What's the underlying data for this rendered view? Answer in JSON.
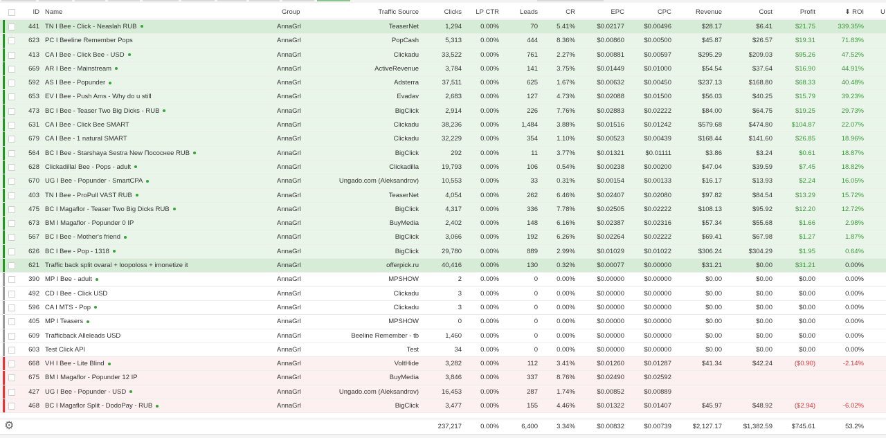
{
  "tabs": [
    "",
    "",
    "",
    "",
    "",
    "",
    "",
    "",
    "",
    "",
    ""
  ],
  "columns": {
    "id": "ID",
    "name": "Name",
    "group": "Group",
    "source": "Traffic Source",
    "clicks": "Clicks",
    "lpctr": "LP CTR",
    "leads": "Leads",
    "cr": "CR",
    "epc": "EPC",
    "cpc": "CPC",
    "revenue": "Revenue",
    "cost": "Cost",
    "profit": "Profit",
    "roi": "ROI",
    "extra": "U"
  },
  "sort_indicator": "⬇",
  "rows": [
    {
      "id": "441",
      "name": "TN I Bee - Click - Neaslah RUB",
      "dot": true,
      "group": "AnnaGrl",
      "source": "TeaserNet",
      "clicks": "1,294",
      "lpctr": "0.00%",
      "leads": "70",
      "cr": "5.41%",
      "epc": "$0.02177",
      "cpc": "$0.00496",
      "revenue": "$28.17",
      "cost": "$6.41",
      "profit": "$21.75",
      "roi": "339.35%",
      "status": "green",
      "hi": true
    },
    {
      "id": "623",
      "name": "PC I Beeline Remember Pops",
      "dot": false,
      "group": "AnnaGrl",
      "source": "PopCash",
      "clicks": "5,313",
      "lpctr": "0.00%",
      "leads": "444",
      "cr": "8.36%",
      "epc": "$0.00860",
      "cpc": "$0.00500",
      "revenue": "$45.87",
      "cost": "$26.57",
      "profit": "$19.31",
      "roi": "71.83%",
      "status": "green"
    },
    {
      "id": "413",
      "name": "CA I Bee - Click Bee - USD",
      "dot": true,
      "group": "AnnaGrl",
      "source": "Clickadu",
      "clicks": "33,522",
      "lpctr": "0.00%",
      "leads": "761",
      "cr": "2.27%",
      "epc": "$0.00881",
      "cpc": "$0.00597",
      "revenue": "$295.29",
      "cost": "$209.03",
      "profit": "$95.26",
      "roi": "47.52%",
      "status": "green"
    },
    {
      "id": "669",
      "name": "AR I Bee - Mainstream",
      "dot": true,
      "group": "AnnaGrl",
      "source": "ActiveRevenue",
      "clicks": "3,784",
      "lpctr": "0.00%",
      "leads": "141",
      "cr": "3.75%",
      "epc": "$0.01449",
      "cpc": "$0.01000",
      "revenue": "$54.54",
      "cost": "$37.64",
      "profit": "$16.90",
      "roi": "44.91%",
      "status": "green"
    },
    {
      "id": "592",
      "name": "AS I Bee - Popunder",
      "dot": true,
      "group": "AnnaGrl",
      "source": "Adsterra",
      "clicks": "37,511",
      "lpctr": "0.00%",
      "leads": "625",
      "cr": "1.67%",
      "epc": "$0.00632",
      "cpc": "$0.00450",
      "revenue": "$237.13",
      "cost": "$168.80",
      "profit": "$68.33",
      "roi": "40.48%",
      "status": "green"
    },
    {
      "id": "653",
      "name": "EV I Bee - Push Ams - Why do u still",
      "dot": false,
      "group": "AnnaGrl",
      "source": "Evadav",
      "clicks": "2,683",
      "lpctr": "0.00%",
      "leads": "127",
      "cr": "4.73%",
      "epc": "$0.02088",
      "cpc": "$0.01500",
      "revenue": "$56.03",
      "cost": "$40.25",
      "profit": "$15.79",
      "roi": "39.23%",
      "status": "green"
    },
    {
      "id": "473",
      "name": "BC I Bee - Teaser Two Big Dicks - RUB",
      "dot": true,
      "group": "AnnaGrl",
      "source": "BigClick",
      "clicks": "2,914",
      "lpctr": "0.00%",
      "leads": "226",
      "cr": "7.76%",
      "epc": "$0.02883",
      "cpc": "$0.02222",
      "revenue": "$84.00",
      "cost": "$64.75",
      "profit": "$19.25",
      "roi": "29.73%",
      "status": "green"
    },
    {
      "id": "631",
      "name": "CA I Bee - Click Bee SMART",
      "dot": false,
      "group": "AnnaGrl",
      "source": "Clickadu",
      "clicks": "38,236",
      "lpctr": "0.00%",
      "leads": "1,484",
      "cr": "3.88%",
      "epc": "$0.01516",
      "cpc": "$0.01242",
      "revenue": "$579.68",
      "cost": "$474.80",
      "profit": "$104.87",
      "roi": "22.07%",
      "status": "green"
    },
    {
      "id": "679",
      "name": "CA I Bee - 1 natural SMART",
      "dot": false,
      "group": "AnnaGrl",
      "source": "Clickadu",
      "clicks": "32,229",
      "lpctr": "0.00%",
      "leads": "354",
      "cr": "1.10%",
      "epc": "$0.00523",
      "cpc": "$0.00439",
      "revenue": "$168.44",
      "cost": "$141.60",
      "profit": "$26.85",
      "roi": "18.96%",
      "status": "green"
    },
    {
      "id": "564",
      "name": "BC I Bee - Starshaya Sestra New Пососнее RUB",
      "dot": true,
      "group": "AnnaGrl",
      "source": "BigClick",
      "clicks": "292",
      "lpctr": "0.00%",
      "leads": "11",
      "cr": "3.77%",
      "epc": "$0.01321",
      "cpc": "$0.01111",
      "revenue": "$3.86",
      "cost": "$3.24",
      "profit": "$0.61",
      "roi": "18.87%",
      "status": "green"
    },
    {
      "id": "628",
      "name": "ClickadillaI Bee - Pops - adult",
      "dot": true,
      "group": "AnnaGrl",
      "source": "Clickadilla",
      "clicks": "19,793",
      "lpctr": "0.00%",
      "leads": "106",
      "cr": "0.54%",
      "epc": "$0.00238",
      "cpc": "$0.00200",
      "revenue": "$47.04",
      "cost": "$39.59",
      "profit": "$7.45",
      "roi": "18.82%",
      "status": "green"
    },
    {
      "id": "670",
      "name": "UG I Bee - Popunder - SmartCPA",
      "dot": true,
      "group": "AnnaGrl",
      "source": "Ungado.com (Aleksandrov)",
      "clicks": "10,553",
      "lpctr": "0.00%",
      "leads": "33",
      "cr": "0.31%",
      "epc": "$0.00154",
      "cpc": "$0.00133",
      "revenue": "$16.17",
      "cost": "$13.93",
      "profit": "$2.24",
      "roi": "16.05%",
      "status": "green"
    },
    {
      "id": "403",
      "name": "TN I Bee - ProPull VAST RUB",
      "dot": true,
      "group": "AnnaGrl",
      "source": "TeaserNet",
      "clicks": "4,054",
      "lpctr": "0.00%",
      "leads": "262",
      "cr": "6.46%",
      "epc": "$0.02407",
      "cpc": "$0.02080",
      "revenue": "$97.82",
      "cost": "$84.54",
      "profit": "$13.29",
      "roi": "15.72%",
      "status": "green"
    },
    {
      "id": "475",
      "name": "BC I Magaflor - Teaser Two Big Dicks RUB",
      "dot": true,
      "group": "AnnaGrl",
      "source": "BigClick",
      "clicks": "4,317",
      "lpctr": "0.00%",
      "leads": "336",
      "cr": "7.78%",
      "epc": "$0.02505",
      "cpc": "$0.02222",
      "revenue": "$108.13",
      "cost": "$95.92",
      "profit": "$12.20",
      "roi": "12.72%",
      "status": "green"
    },
    {
      "id": "673",
      "name": "BM I Magaflor - Popunder 0 IP",
      "dot": false,
      "group": "AnnaGrl",
      "source": "BuyMedia",
      "clicks": "2,402",
      "lpctr": "0.00%",
      "leads": "148",
      "cr": "6.16%",
      "epc": "$0.02387",
      "cpc": "$0.02316",
      "revenue": "$57.34",
      "cost": "$55.68",
      "profit": "$1.66",
      "roi": "2.98%",
      "status": "green"
    },
    {
      "id": "567",
      "name": "BC I Bee - Mother's friend",
      "dot": true,
      "group": "AnnaGrl",
      "source": "BigClick",
      "clicks": "3,066",
      "lpctr": "0.00%",
      "leads": "192",
      "cr": "6.26%",
      "epc": "$0.02264",
      "cpc": "$0.02222",
      "revenue": "$69.41",
      "cost": "$67.98",
      "profit": "$1.27",
      "roi": "1.87%",
      "status": "green"
    },
    {
      "id": "626",
      "name": "BC I Bee - Pop - 1318",
      "dot": true,
      "group": "AnnaGrl",
      "source": "BigClick",
      "clicks": "29,780",
      "lpctr": "0.00%",
      "leads": "889",
      "cr": "2.99%",
      "epc": "$0.01029",
      "cpc": "$0.01022",
      "revenue": "$306.24",
      "cost": "$304.29",
      "profit": "$1.95",
      "roi": "0.64%",
      "status": "green"
    },
    {
      "id": "621",
      "name": "Traffic back split ovaral + loopoloss + imonetize it",
      "dot": false,
      "group": "AnnaGrl",
      "source": "offerpick.ru",
      "clicks": "40,416",
      "lpctr": "0.00%",
      "leads": "130",
      "cr": "0.32%",
      "epc": "$0.00077",
      "cpc": "$0.00000",
      "revenue": "$31.21",
      "cost": "$0.00",
      "profit": "$31.21",
      "roi": "0.00%",
      "status": "green",
      "hi": true
    },
    {
      "id": "390",
      "name": "MP I Bee - adult",
      "dot": true,
      "group": "AnnaGrl",
      "source": "MPSHOW",
      "clicks": "2",
      "lpctr": "0.00%",
      "leads": "0",
      "cr": "0.00%",
      "epc": "$0.00000",
      "cpc": "$0.00000",
      "revenue": "$0.00",
      "cost": "$0.00",
      "profit": "$0.00",
      "roi": "0.00%",
      "status": "grey"
    },
    {
      "id": "492",
      "name": "CD I Bee - Click USD",
      "dot": false,
      "group": "AnnaGrl",
      "source": "Clickadu",
      "clicks": "3",
      "lpctr": "0.00%",
      "leads": "0",
      "cr": "0.00%",
      "epc": "$0.00000",
      "cpc": "$0.00000",
      "revenue": "$0.00",
      "cost": "$0.00",
      "profit": "$0.00",
      "roi": "0.00%",
      "status": "grey"
    },
    {
      "id": "596",
      "name": "CA I MTS - Pop",
      "dot": true,
      "group": "AnnaGrl",
      "source": "Clickadu",
      "clicks": "3",
      "lpctr": "0.00%",
      "leads": "0",
      "cr": "0.00%",
      "epc": "$0.00000",
      "cpc": "$0.00000",
      "revenue": "$0.00",
      "cost": "$0.00",
      "profit": "$0.00",
      "roi": "0.00%",
      "status": "grey"
    },
    {
      "id": "405",
      "name": "MP I Teasers",
      "dot": true,
      "group": "AnnaGrl",
      "source": "MPSHOW",
      "clicks": "0",
      "lpctr": "0.00%",
      "leads": "0",
      "cr": "0.00%",
      "epc": "$0.00000",
      "cpc": "$0.00000",
      "revenue": "$0.00",
      "cost": "$0.00",
      "profit": "$0.00",
      "roi": "0.00%",
      "status": "grey"
    },
    {
      "id": "609",
      "name": "Trafficback Alleleads USD",
      "dot": false,
      "group": "AnnaGrl",
      "source": "Beeline Remember - tb",
      "clicks": "1,460",
      "lpctr": "0.00%",
      "leads": "0",
      "cr": "0.00%",
      "epc": "$0.00000",
      "cpc": "$0.00000",
      "revenue": "$0.00",
      "cost": "$0.00",
      "profit": "$0.00",
      "roi": "0.00%",
      "status": "grey"
    },
    {
      "id": "603",
      "name": "Test Click API",
      "dot": false,
      "group": "AnnaGrl",
      "source": "Test",
      "clicks": "34",
      "lpctr": "0.00%",
      "leads": "0",
      "cr": "0.00%",
      "epc": "$0.00000",
      "cpc": "$0.00000",
      "revenue": "$0.00",
      "cost": "$0.00",
      "profit": "$0.00",
      "roi": "0.00%",
      "status": "grey"
    },
    {
      "id": "668",
      "name": "VH I Bee - Lite Blind",
      "dot": true,
      "group": "AnnaGrl",
      "source": "VoltHide",
      "clicks": "3,282",
      "lpctr": "0.00%",
      "leads": "112",
      "cr": "3.41%",
      "epc": "$0.01260",
      "cpc": "$0.01287",
      "revenue": "$41.34",
      "cost": "$42.24",
      "profit": "($0.90)",
      "roi": "-2.14%",
      "status": "red"
    },
    {
      "id": "675",
      "name": "BM I Magaflor - Popunder 12 IP",
      "dot": false,
      "group": "AnnaGrl",
      "source": "BuyMedia",
      "clicks": "3,846",
      "lpctr": "0.00%",
      "leads": "337",
      "cr": "8.76%",
      "epc": "$0.02490",
      "cpc": "$0.02592",
      "revenue": "",
      "cost": "",
      "profit": "",
      "roi": "",
      "status": "red"
    },
    {
      "id": "427",
      "name": "UG I Bee - Popunder - USD",
      "dot": true,
      "group": "AnnaGrl",
      "source": "Ungado.com (Aleksandrov)",
      "clicks": "16,453",
      "lpctr": "0.00%",
      "leads": "287",
      "cr": "1.74%",
      "epc": "$0.00852",
      "cpc": "$0.00889",
      "revenue": "",
      "cost": "",
      "profit": "",
      "roi": "",
      "status": "red"
    },
    {
      "id": "468",
      "name": "BC I Magaflor Split - DodoPay - RUB",
      "dot": true,
      "group": "AnnaGrl",
      "source": "BigClick",
      "clicks": "3,477",
      "lpctr": "0.00%",
      "leads": "155",
      "cr": "4.46%",
      "epc": "$0.01322",
      "cpc": "$0.01407",
      "revenue": "$45.97",
      "cost": "$48.92",
      "profit": "($2.94)",
      "roi": "-6.02%",
      "status": "red"
    }
  ],
  "totals": {
    "clicks": "237,217",
    "lpctr": "0.00%",
    "leads": "6,400",
    "cr": "3.34%",
    "epc": "$0.00832",
    "cpc": "$0.00739",
    "revenue": "$2,127.17",
    "cost": "$1,382.59",
    "profit": "$745.61",
    "roi": "53.2%"
  },
  "colors": {
    "positive": "#3a963a",
    "negative": "#d23b3b",
    "green_row": "#eaf5ea",
    "red_row": "#fdf0f0"
  },
  "icons": {
    "settings": "gear-icon"
  }
}
